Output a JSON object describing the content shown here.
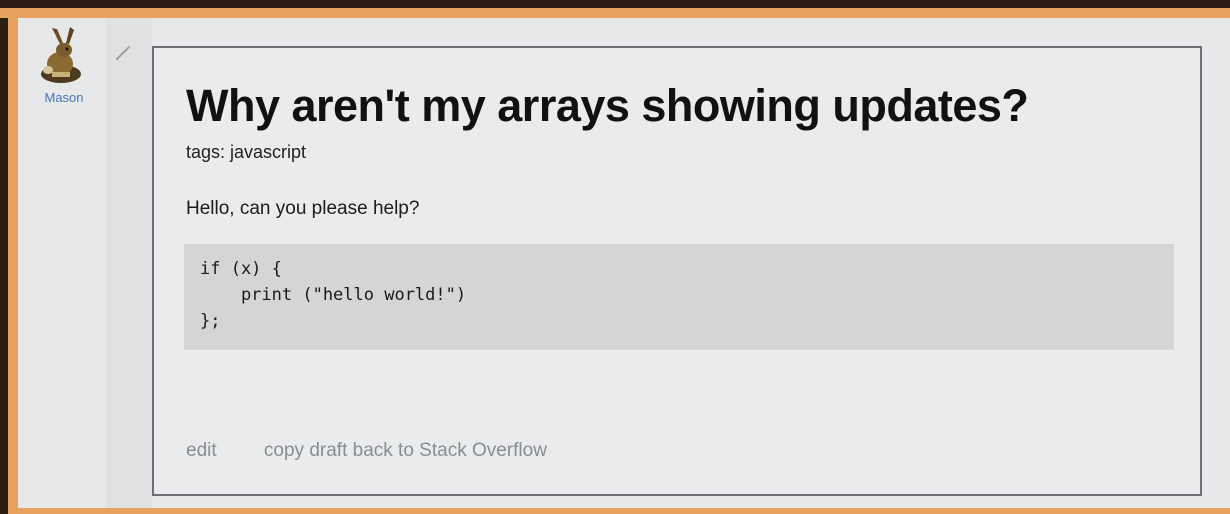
{
  "user": {
    "name": "Mason",
    "avatar_icon": "rabbit-avatar-icon"
  },
  "edit_icon": "pencil-icon",
  "post": {
    "title": "Why aren't my arrays showing updates?",
    "tags": "tags: javascript",
    "body": "Hello, can you please help?",
    "code": "if (x) {\n    print (\"hello world!\")\n};"
  },
  "actions": {
    "edit_label": "edit",
    "copy_label": "copy draft back to Stack Overflow"
  },
  "colors": {
    "frame_border": "#e8a260",
    "background": "#e6e8ea",
    "code_background": "#d4d5d6",
    "link": "#4a74b8",
    "muted_action": "#8a8d90"
  }
}
